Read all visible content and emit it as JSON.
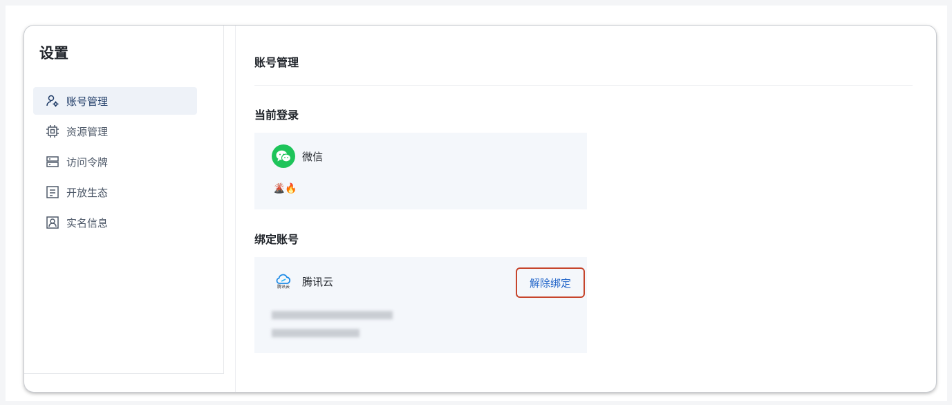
{
  "sidebar": {
    "title": "设置",
    "items": [
      {
        "label": "账号管理",
        "icon": "user-settings-icon",
        "active": true
      },
      {
        "label": "资源管理",
        "icon": "chip-icon",
        "active": false
      },
      {
        "label": "访问令牌",
        "icon": "server-icon",
        "active": false
      },
      {
        "label": "开放生态",
        "icon": "document-icon",
        "active": false
      },
      {
        "label": "实名信息",
        "icon": "id-card-icon",
        "active": false
      }
    ]
  },
  "main": {
    "title": "账号管理",
    "current_login": {
      "section_title": "当前登录",
      "provider": "微信",
      "provider_icon": "wechat-icon",
      "nickname": "🌋🔥"
    },
    "bound_accounts": {
      "section_title": "绑定账号",
      "provider": "腾讯云",
      "provider_icon": "tencent-cloud-icon",
      "logo_caption": "腾讯云",
      "unbind_label": "解除绑定"
    }
  },
  "colors": {
    "active_nav_bg": "#eef2f8",
    "card_bg": "#f4f7fb",
    "link_blue": "#1f63c8",
    "highlight_red": "#c6452c",
    "wechat_green": "#1ec45a"
  }
}
